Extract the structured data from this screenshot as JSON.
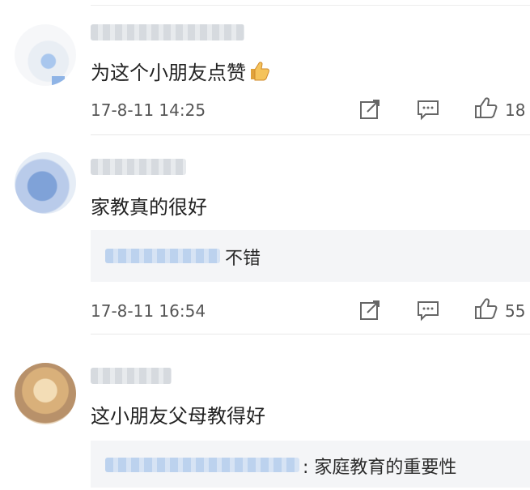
{
  "comments": [
    {
      "text": "为这个小朋友点赞",
      "time": "17-8-11 14:25",
      "likes": "18",
      "emoji": "thumbs-up-emoji"
    },
    {
      "text": "家教真的很好",
      "reply_text": "不错",
      "time": "17-8-11 16:54",
      "likes": "55"
    },
    {
      "text": "这小朋友父母教得好",
      "reply_text": ": 家庭教育的重要性"
    }
  ],
  "icons": {
    "share": "share-icon",
    "comment": "comment-icon",
    "like": "like-icon"
  },
  "colors": {
    "text": "#222222",
    "meta": "#555555",
    "reply_bg": "#f4f5f7",
    "divider": "#e8e8e8"
  }
}
